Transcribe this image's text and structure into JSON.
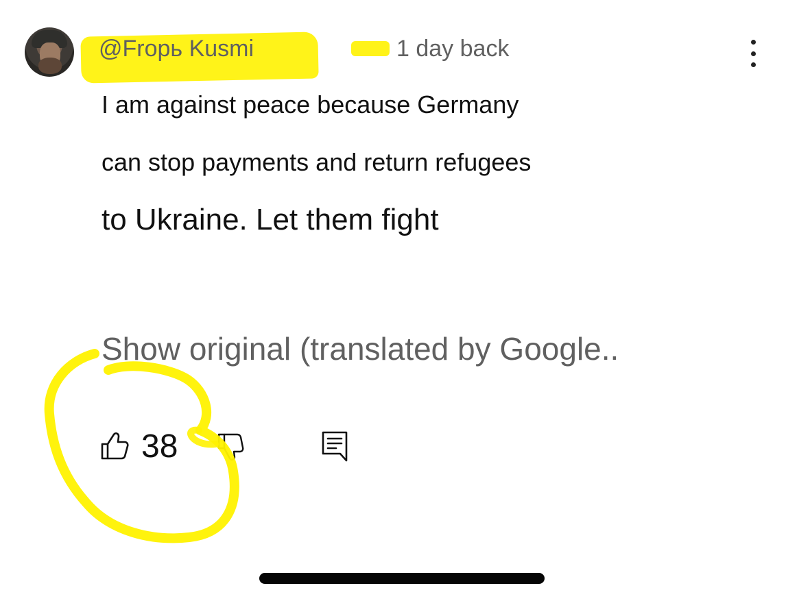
{
  "comment": {
    "author": "@Fropь Kusmi",
    "timestamp": "1 day back",
    "text_lines": [
      "I am against peace because Germany",
      "can stop payments and return refugees",
      "to Ukraine. Let them fight"
    ],
    "show_original_label": "Show original (translated by Google..",
    "like_count": "38",
    "icons": {
      "like": "thumb-up-icon",
      "dislike": "thumb-down-icon",
      "reply": "comment-icon",
      "more": "vertical-dots-icon"
    }
  },
  "annotations": {
    "highlight_color": "#fff200"
  }
}
